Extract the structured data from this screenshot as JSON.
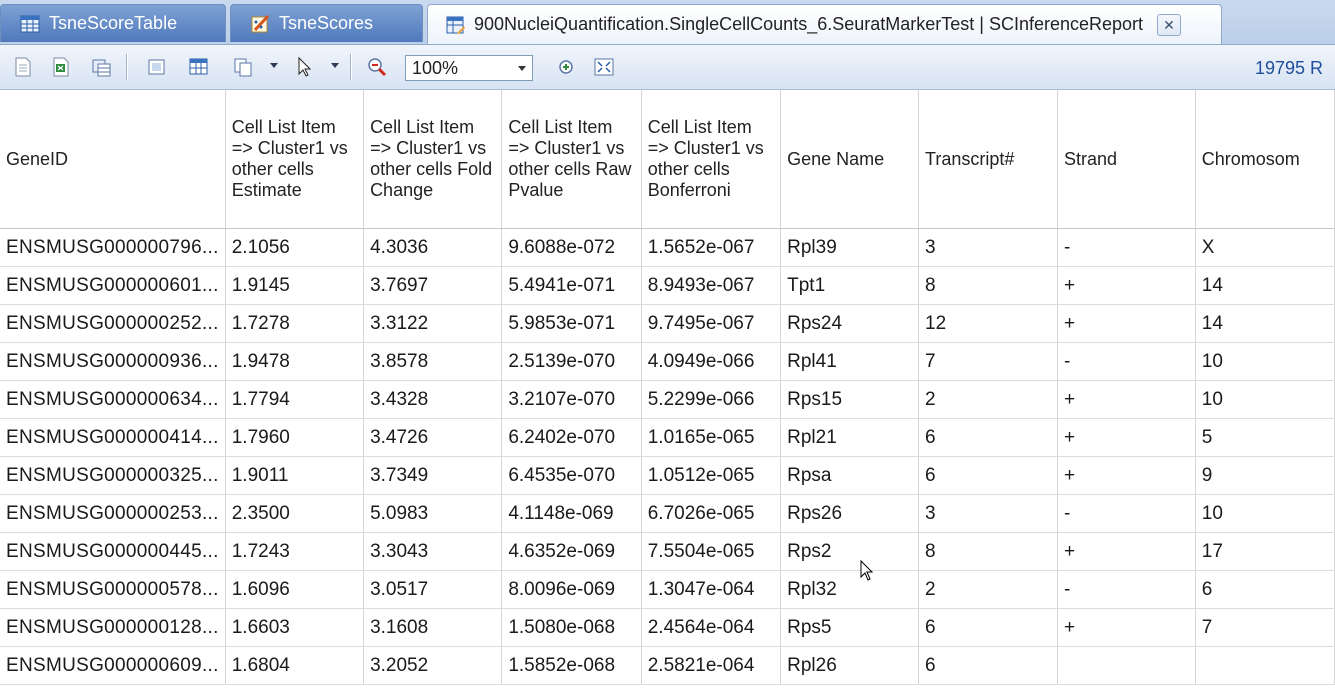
{
  "tabs": [
    {
      "label": "TsneScoreTable",
      "icon": "table-icon"
    },
    {
      "label": "TsneScores",
      "icon": "scatter-plot-icon"
    },
    {
      "label": "900NucleiQuantification.SingleCellCounts_6.SeuratMarkerTest | SCInferenceReport",
      "icon": "report-icon",
      "active": true
    }
  ],
  "toolbar": {
    "zoom_value": "100%",
    "row_count": "19795 R"
  },
  "table": {
    "columns": [
      "GeneID",
      "Cell List Item => Cluster1 vs other cells Estimate",
      "Cell List Item => Cluster1 vs other cells Fold Change",
      "Cell List Item => Cluster1 vs other cells Raw Pvalue",
      "Cell List Item => Cluster1 vs other cells Bonferroni",
      "Gene Name",
      "Transcript#",
      "Strand",
      "Chromosom"
    ],
    "rows": [
      [
        "ENSMUSG000000796...",
        "2.1056",
        "4.3036",
        "9.6088e-072",
        "1.5652e-067",
        "Rpl39",
        "3",
        "-",
        "X"
      ],
      [
        "ENSMUSG000000601...",
        "1.9145",
        "3.7697",
        "5.4941e-071",
        "8.9493e-067",
        "Tpt1",
        "8",
        "+",
        "14"
      ],
      [
        "ENSMUSG000000252...",
        "1.7278",
        "3.3122",
        "5.9853e-071",
        "9.7495e-067",
        "Rps24",
        "12",
        "+",
        "14"
      ],
      [
        "ENSMUSG000000936...",
        "1.9478",
        "3.8578",
        "2.5139e-070",
        "4.0949e-066",
        "Rpl41",
        "7",
        "-",
        "10"
      ],
      [
        "ENSMUSG000000634...",
        "1.7794",
        "3.4328",
        "3.2107e-070",
        "5.2299e-066",
        "Rps15",
        "2",
        "+",
        "10"
      ],
      [
        "ENSMUSG000000414...",
        "1.7960",
        "3.4726",
        "6.2402e-070",
        "1.0165e-065",
        "Rpl21",
        "6",
        "+",
        "5"
      ],
      [
        "ENSMUSG000000325...",
        "1.9011",
        "3.7349",
        "6.4535e-070",
        "1.0512e-065",
        "Rpsa",
        "6",
        "+",
        "9"
      ],
      [
        "ENSMUSG000000253...",
        "2.3500",
        "5.0983",
        "4.1148e-069",
        "6.7026e-065",
        "Rps26",
        "3",
        "-",
        "10"
      ],
      [
        "ENSMUSG000000445...",
        "1.7243",
        "3.3043",
        "4.6352e-069",
        "7.5504e-065",
        "Rps2",
        "8",
        "+",
        "17"
      ],
      [
        "ENSMUSG000000578...",
        "1.6096",
        "3.0517",
        "8.0096e-069",
        "1.3047e-064",
        "Rpl32",
        "2",
        "-",
        "6"
      ],
      [
        "ENSMUSG000000128...",
        "1.6603",
        "3.1608",
        "1.5080e-068",
        "2.4564e-064",
        "Rps5",
        "6",
        "+",
        "7"
      ],
      [
        "ENSMUSG000000609...",
        "1.6804",
        "3.2052",
        "1.5852e-068",
        "2.5821e-064",
        "Rpl26",
        "6",
        "",
        ""
      ]
    ]
  }
}
